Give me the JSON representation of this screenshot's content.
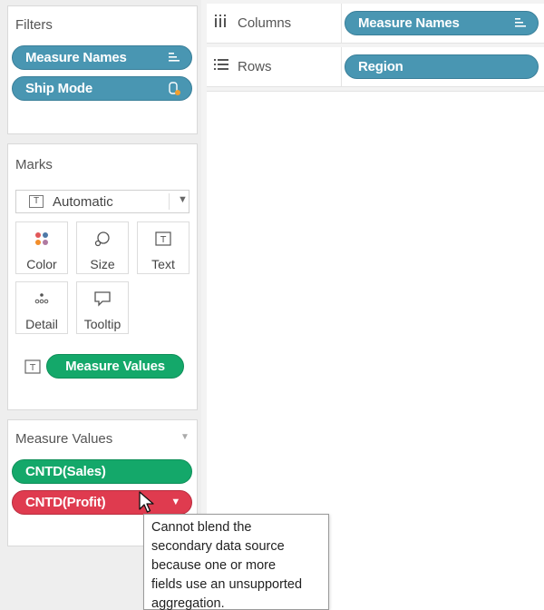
{
  "filters": {
    "title": "Filters",
    "pills": [
      {
        "label": "Measure Names",
        "icon": "filter-list-icon"
      },
      {
        "label": "Ship Mode",
        "icon": "context-filter-icon"
      }
    ]
  },
  "marks": {
    "title": "Marks",
    "mark_type": "Automatic",
    "buttons": [
      {
        "label": "Color",
        "icon": "color-dots-icon"
      },
      {
        "label": "Size",
        "icon": "size-icon"
      },
      {
        "label": "Text",
        "icon": "text-icon"
      },
      {
        "label": "Detail",
        "icon": "detail-icon"
      },
      {
        "label": "Tooltip",
        "icon": "tooltip-icon"
      }
    ],
    "text_pill": "Measure Values"
  },
  "measure_values": {
    "title": "Measure Values",
    "pills": [
      {
        "label": "CNTD(Sales)",
        "status": "ok"
      },
      {
        "label": "CNTD(Profit)",
        "status": "error"
      }
    ]
  },
  "shelves": {
    "columns": {
      "label": "Columns",
      "pill": "Measure Names"
    },
    "rows": {
      "label": "Rows",
      "pill": "Region"
    }
  },
  "tooltip": {
    "lines": [
      "Cannot blend the",
      "secondary data source",
      "because one or more",
      "fields use an unsupported",
      "aggregation."
    ]
  },
  "colors": {
    "dimension_pill": "#4996b2",
    "measure_pill": "#14a86a",
    "error_pill": "#df3b4f"
  }
}
